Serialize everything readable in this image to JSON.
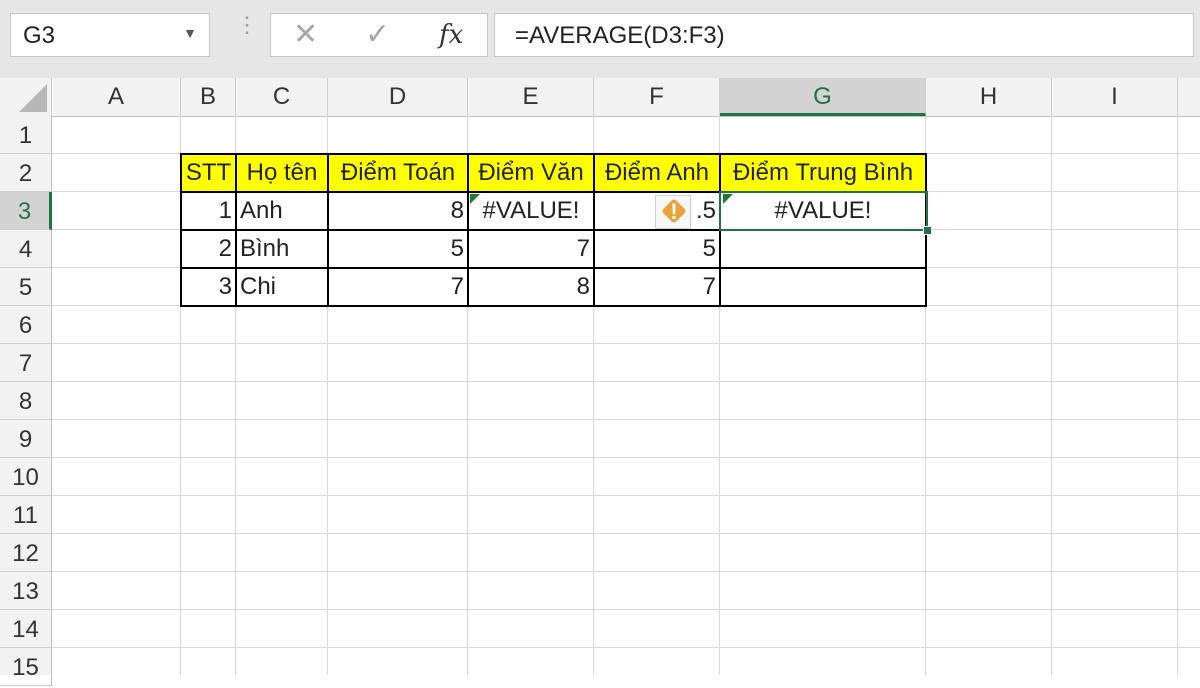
{
  "formula_bar": {
    "name_box": "G3",
    "cancel_icon": "✕",
    "enter_icon": "✓",
    "fx_label": "fx",
    "formula": "=AVERAGE(D3:F3)"
  },
  "columns": [
    "A",
    "B",
    "C",
    "D",
    "E",
    "F",
    "G",
    "H",
    "I"
  ],
  "rows": [
    "1",
    "2",
    "3",
    "4",
    "5",
    "6",
    "7",
    "8",
    "9",
    "10",
    "11",
    "12",
    "13",
    "14",
    "15"
  ],
  "selected_cell": {
    "column": "G",
    "row": "3"
  },
  "table": {
    "headers": [
      "STT",
      "Họ tên",
      "Điểm Toán",
      "Điểm Văn",
      "Điểm Anh",
      "Điểm Trung Bình"
    ],
    "rows": [
      [
        "1",
        "Anh",
        "8",
        "#VALUE!",
        ".5",
        "#VALUE!"
      ],
      [
        "2",
        "Bình",
        "5",
        "7",
        "5",
        ""
      ],
      [
        "3",
        "Chi",
        "7",
        "8",
        "7",
        ""
      ]
    ]
  },
  "colors": {
    "header_fill": "#ffff00",
    "excel_green": "#217346",
    "warning": "#e8a33c"
  },
  "icons": {
    "warning": "warning-diamond-icon",
    "error_flag": "error-indicator-icon"
  }
}
